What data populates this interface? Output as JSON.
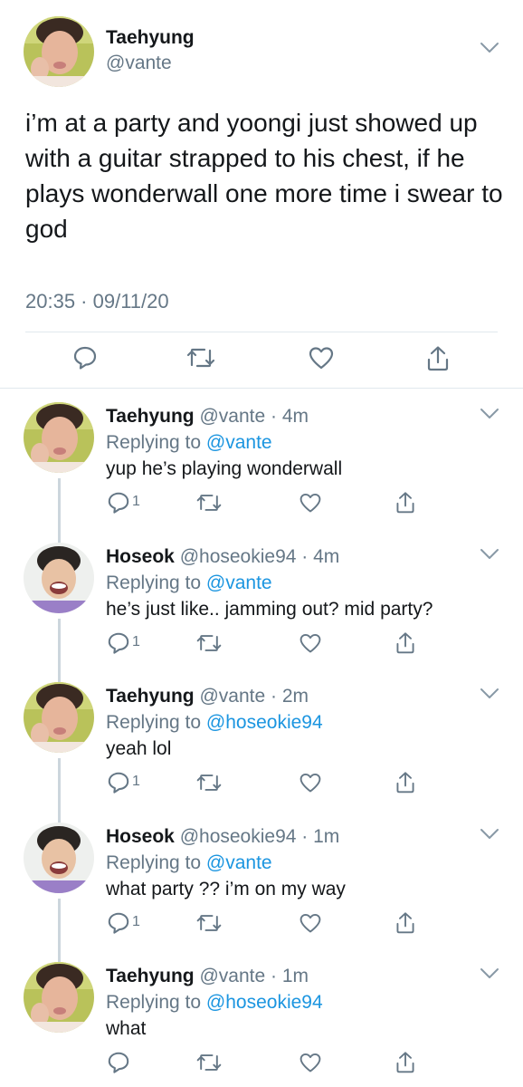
{
  "main_tweet": {
    "display_name": "Taehyung",
    "handle": "@vante",
    "text": "i’m at a party and yoongi just showed up with a guitar strapped to his chest, if he plays wonderwall one more time i swear to god",
    "timestamp": "20:35 · 09/11/20",
    "avatar_icon": "taehyung-avatar",
    "actions": [
      "reply-icon",
      "retweet-icon",
      "like-icon",
      "share-icon"
    ]
  },
  "replies": [
    {
      "display_name": "Taehyung",
      "handle": "@vante",
      "time": "· 4m",
      "replying_prefix": "Replying to",
      "replying_to": "@vante",
      "text": "yup he’s playing wonderwall",
      "reply_count": "1",
      "avatar": "taehyung"
    },
    {
      "display_name": "Hoseok",
      "handle": "@hoseokie94",
      "time": "· 4m",
      "replying_prefix": "Replying to",
      "replying_to": "@vante",
      "text": "he’s just like.. jamming out? mid party?",
      "reply_count": "1",
      "avatar": "hoseok"
    },
    {
      "display_name": "Taehyung",
      "handle": "@vante",
      "time": "· 2m",
      "replying_prefix": "Replying to",
      "replying_to": "@hoseokie94",
      "text": "yeah lol",
      "reply_count": "1",
      "avatar": "taehyung"
    },
    {
      "display_name": "Hoseok",
      "handle": "@hoseokie94",
      "time": "· 1m",
      "replying_prefix": "Replying to",
      "replying_to": "@vante",
      "text": "what party ?? i’m on my way",
      "reply_count": "1",
      "avatar": "hoseok"
    },
    {
      "display_name": "Taehyung",
      "handle": "@vante",
      "time": "· 1m",
      "replying_prefix": "Replying to",
      "replying_to": "@hoseokie94",
      "text": "what",
      "reply_count": "",
      "avatar": "taehyung"
    }
  ],
  "colors": {
    "text": "#14171a",
    "secondary": "#657786",
    "link": "#1b95e0",
    "divider": "#e1e8ed",
    "thread": "#ccd6dd"
  }
}
